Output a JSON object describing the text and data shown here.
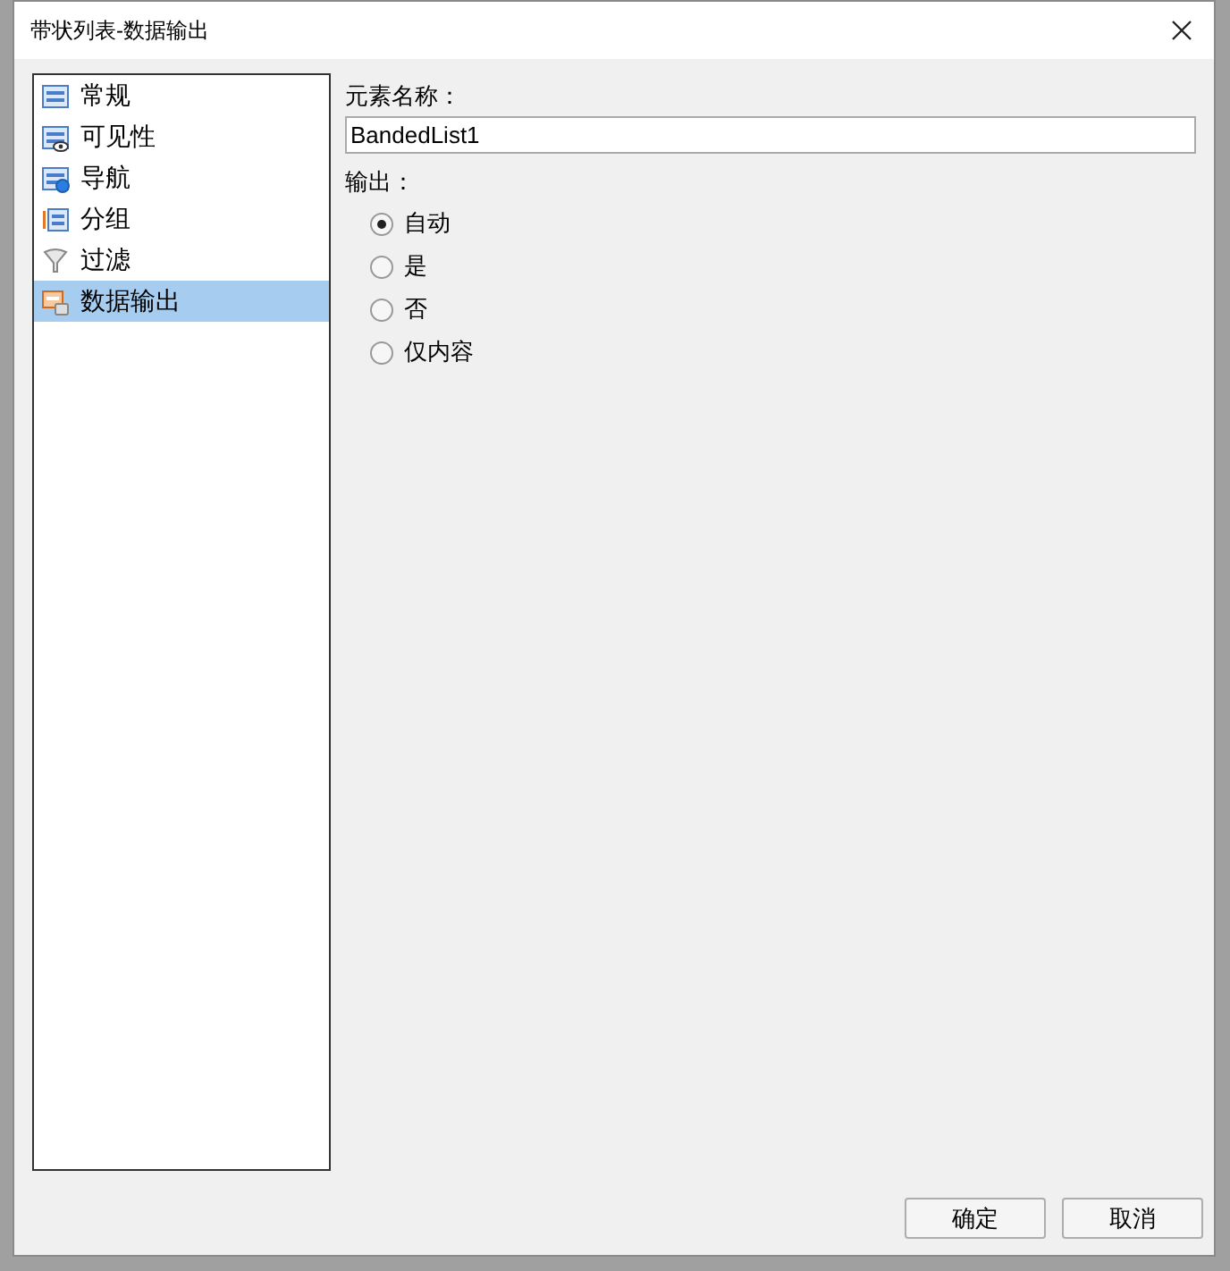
{
  "window": {
    "title": "带状列表-数据输出"
  },
  "sidebar": {
    "items": [
      {
        "label": "常规",
        "kind": "list",
        "selected": false
      },
      {
        "label": "可见性",
        "kind": "visibility",
        "selected": false
      },
      {
        "label": "导航",
        "kind": "navigation",
        "selected": false
      },
      {
        "label": "分组",
        "kind": "group",
        "selected": false
      },
      {
        "label": "过滤",
        "kind": "filter",
        "selected": false
      },
      {
        "label": "数据输出",
        "kind": "export",
        "selected": true
      }
    ]
  },
  "element_name": {
    "label": "元素名称：",
    "value": "BandedList1"
  },
  "output": {
    "label": "输出：",
    "options": [
      {
        "label": "自动",
        "selected": true
      },
      {
        "label": "是",
        "selected": false
      },
      {
        "label": "否",
        "selected": false
      },
      {
        "label": "仅内容",
        "selected": false
      }
    ]
  },
  "buttons": [
    {
      "label": "确定"
    },
    {
      "label": "取消"
    }
  ]
}
